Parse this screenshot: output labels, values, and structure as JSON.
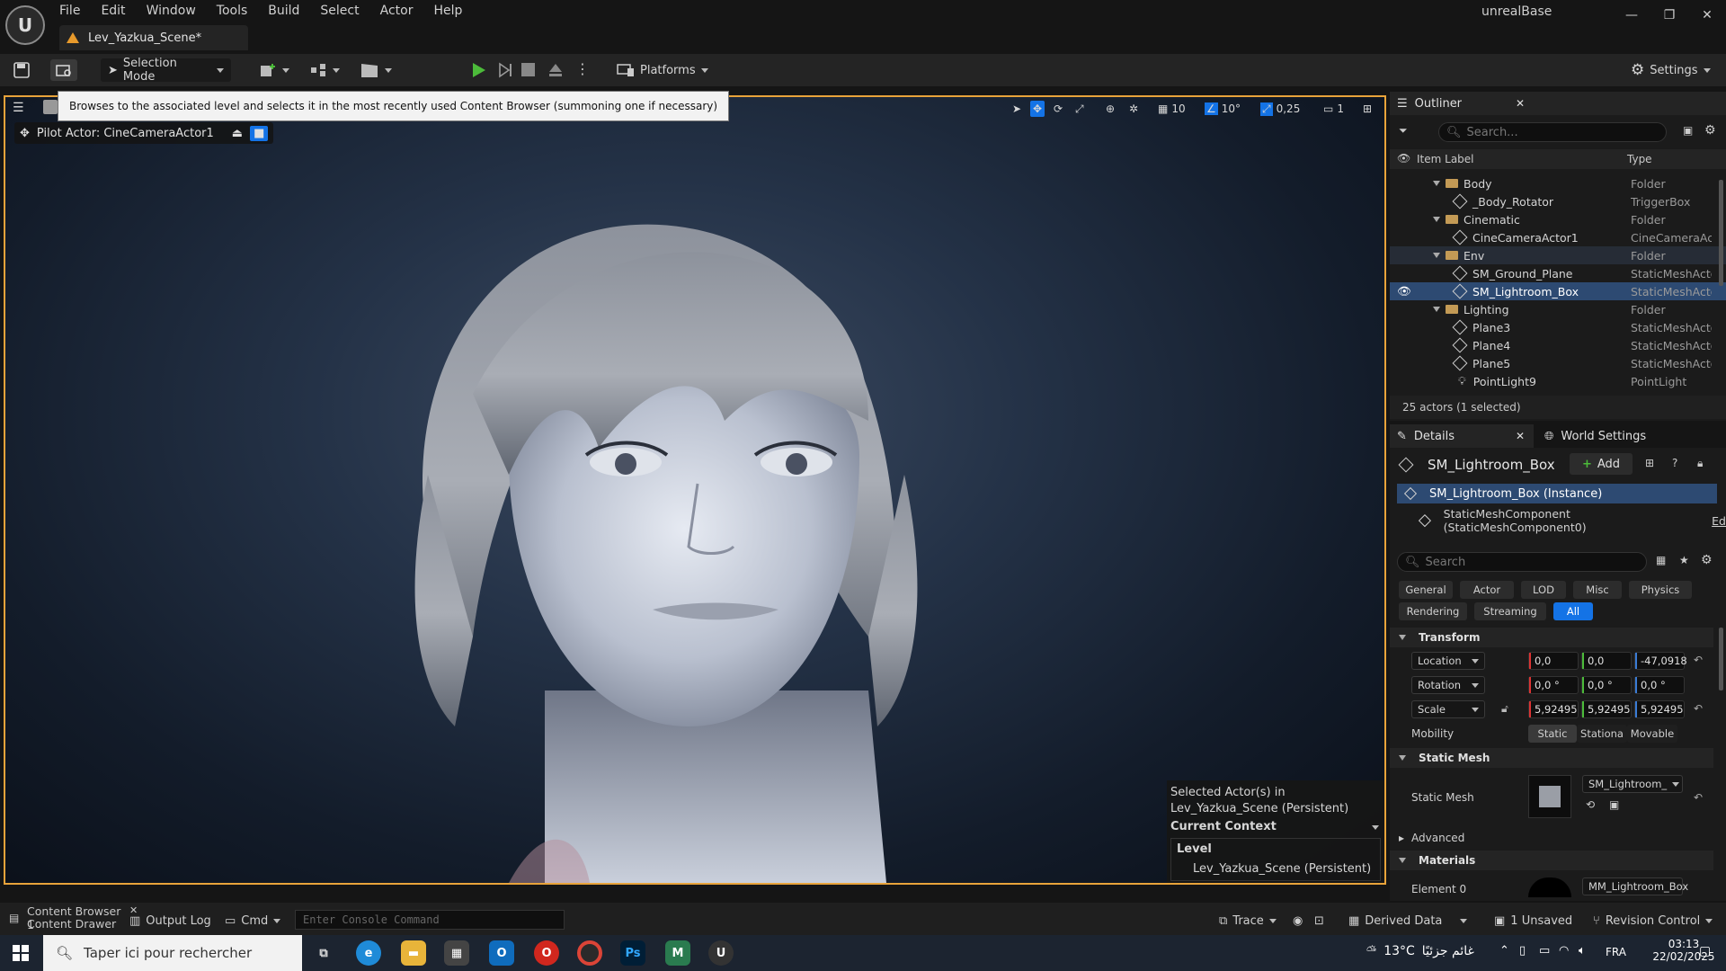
{
  "window": {
    "menu": [
      "File",
      "Edit",
      "Window",
      "Tools",
      "Build",
      "Select",
      "Actor",
      "Help"
    ],
    "doc_tab": "Lev_Yazkua_Scene*",
    "project_name": "unrealBase"
  },
  "toolbar": {
    "selection_mode": "Selection Mode",
    "platforms": "Platforms",
    "settings": "Settings"
  },
  "viewport": {
    "tooltip": "Browses to the associated level and selects it in the most recently used Content Browser (summoning one if necessary)",
    "pilot_actor": "Pilot Actor: CineCameraActor1",
    "grid_size": "10",
    "rotation_snap": "10°",
    "scale_snap": "0,25",
    "camera_speed": "1",
    "context": {
      "selected_line1": "Selected Actor(s) in",
      "selected_line2": "Lev_Yazkua_Scene (Persistent)",
      "current_context": "Current Context",
      "level_label": "Level",
      "level_value": "Lev_Yazkua_Scene (Persistent)"
    }
  },
  "outliner": {
    "title": "Outliner",
    "search_placeholder": "Search...",
    "col_label": "Item Label",
    "col_type": "Type",
    "rows": [
      {
        "label": "Body",
        "type": "Folder"
      },
      {
        "label": "_Body_Rotator",
        "type": "TriggerBox"
      },
      {
        "label": "Cinematic",
        "type": "Folder"
      },
      {
        "label": "CineCameraActor1",
        "type": "CineCameraAc"
      },
      {
        "label": "Env",
        "type": "Folder"
      },
      {
        "label": "SM_Ground_Plane",
        "type": "StaticMeshActo"
      },
      {
        "label": "SM_Lightroom_Box",
        "type": "StaticMeshActo"
      },
      {
        "label": "Lighting",
        "type": "Folder"
      },
      {
        "label": "Plane3",
        "type": "StaticMeshActo"
      },
      {
        "label": "Plane4",
        "type": "StaticMeshActo"
      },
      {
        "label": "Plane5",
        "type": "StaticMeshActo"
      },
      {
        "label": "PointLight9",
        "type": "PointLight"
      }
    ],
    "footer": "25 actors (1 selected)"
  },
  "details": {
    "tab": "Details",
    "world_settings_tab": "World Settings",
    "actor_name": "SM_Lightroom_Box",
    "add_label": "Add",
    "instance_label": "SM_Lightroom_Box (Instance)",
    "component_label": "StaticMeshComponent (StaticMeshComponent0)",
    "component_edit": "Ed",
    "search_placeholder": "Search",
    "categories": [
      "General",
      "Actor",
      "LOD",
      "Misc",
      "Physics",
      "Rendering",
      "Streaming",
      "All"
    ],
    "transform_header": "Transform",
    "location_label": "Location",
    "location": [
      "0,0",
      "0,0",
      "-47,0918"
    ],
    "rotation_label": "Rotation",
    "rotation": [
      "0,0 °",
      "0,0 °",
      "0,0 °"
    ],
    "scale_label": "Scale",
    "scale": [
      "5,92495",
      "5,92495",
      "5,92495"
    ],
    "mobility_label": "Mobility",
    "mobility_options": [
      "Static",
      "Stationa",
      "Movable"
    ],
    "static_mesh_header": "Static Mesh",
    "static_mesh_label": "Static Mesh",
    "static_mesh_value": "SM_Lightroom_",
    "advanced_label": "Advanced",
    "materials_header": "Materials",
    "element0_label": "Element 0",
    "element0_value": "MM_Lightroom_Box"
  },
  "bottombar": {
    "content_drawer": "Content Drawer",
    "content_browser": "Content Browser 1",
    "output_log": "Output Log",
    "cmd": "Cmd",
    "console_placeholder": "Enter Console Command",
    "trace": "Trace",
    "derived_data": "Derived Data",
    "unsaved": "1 Unsaved",
    "revision_control": "Revision Control"
  },
  "taskbar": {
    "search_placeholder": "Taper ici pour rechercher",
    "temperature": "13°C",
    "weather_text": "غائم جزئيًا",
    "language": "FRA",
    "time": "03:13",
    "date": "22/02/2025"
  },
  "colors": {
    "accent": "#1473e6",
    "viewport_border": "#e8a33a",
    "selection": "#2d4a72",
    "folder": "#c39a55",
    "play_green": "#4cbb3a"
  }
}
